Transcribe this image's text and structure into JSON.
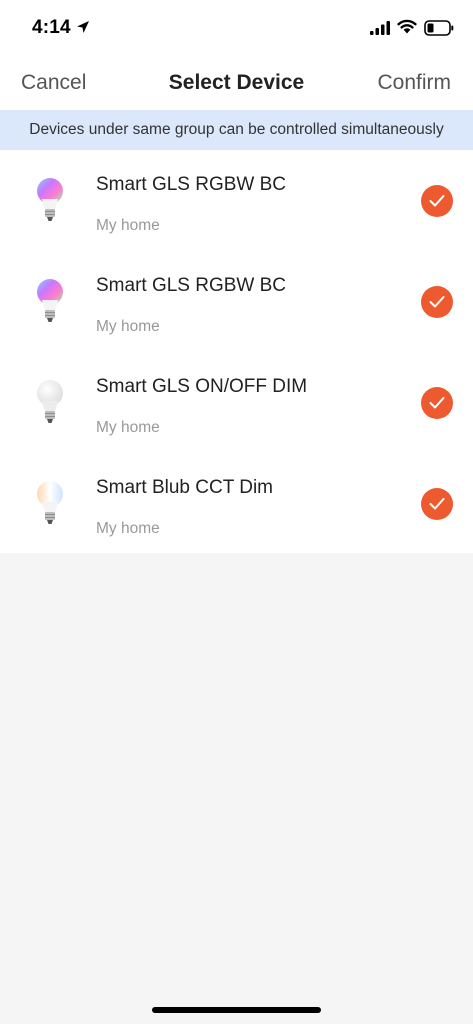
{
  "status_bar": {
    "time": "4:14",
    "icons": [
      "location-arrow-icon",
      "signal-icon",
      "wifi-icon",
      "battery-icon"
    ]
  },
  "nav": {
    "cancel_label": "Cancel",
    "title": "Select Device",
    "confirm_label": "Confirm"
  },
  "notice": {
    "text": "Devices under same group can be controlled simultaneously"
  },
  "devices": [
    {
      "name": "Smart GLS RGBW BC",
      "location": "My home",
      "bulb_icon": "rgbw-bulb-icon",
      "selected": true
    },
    {
      "name": "Smart GLS RGBW BC",
      "location": "My home",
      "bulb_icon": "rgbw-bulb-icon",
      "selected": true
    },
    {
      "name": "Smart GLS ON/OFF DIM",
      "location": "My home",
      "bulb_icon": "white-bulb-icon",
      "selected": true
    },
    {
      "name": "Smart Blub CCT Dim",
      "location": "My home",
      "bulb_icon": "cct-bulb-icon",
      "selected": true
    }
  ],
  "colors": {
    "accent": "#ee5a2f",
    "notice_bg": "#dbe7fb",
    "page_bg": "#f5f5f5"
  }
}
